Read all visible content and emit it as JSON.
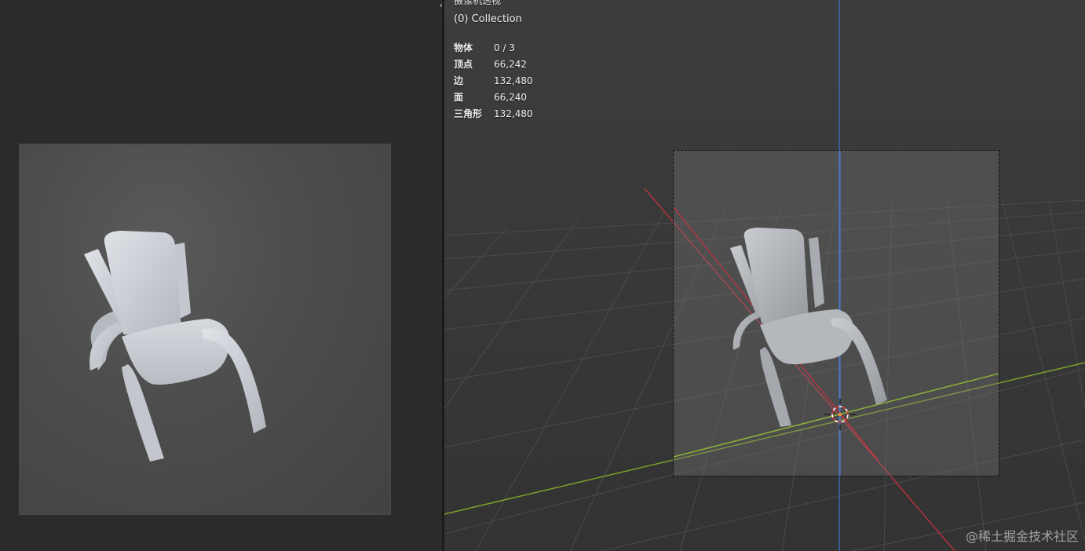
{
  "left_panel": {
    "render_label": "Rendered chair preview"
  },
  "divider": {
    "handle_glyph": "‹›"
  },
  "viewport": {
    "view_name": "摄像机透视",
    "collection": "(0) Collection",
    "stats": [
      {
        "label": "物体",
        "value": "0 / 3"
      },
      {
        "label": "顶点",
        "value": "66,242"
      },
      {
        "label": "边",
        "value": "132,480"
      },
      {
        "label": "面",
        "value": "66,240"
      },
      {
        "label": "三角形",
        "value": "132,480"
      }
    ],
    "watermark": "@稀土掘金技术社区"
  },
  "colors": {
    "background": "#2b2b2b",
    "viewport_bg": "#393939",
    "axis_x": "#c8303f",
    "axis_y": "#7da12b",
    "axis_z": "#3e6fbf",
    "grid": "#4a4a4a",
    "chair": "#c9ccd2"
  },
  "icons": {
    "divider_handle": "resize-arrows-icon",
    "origin": "3d-cursor-icon"
  }
}
